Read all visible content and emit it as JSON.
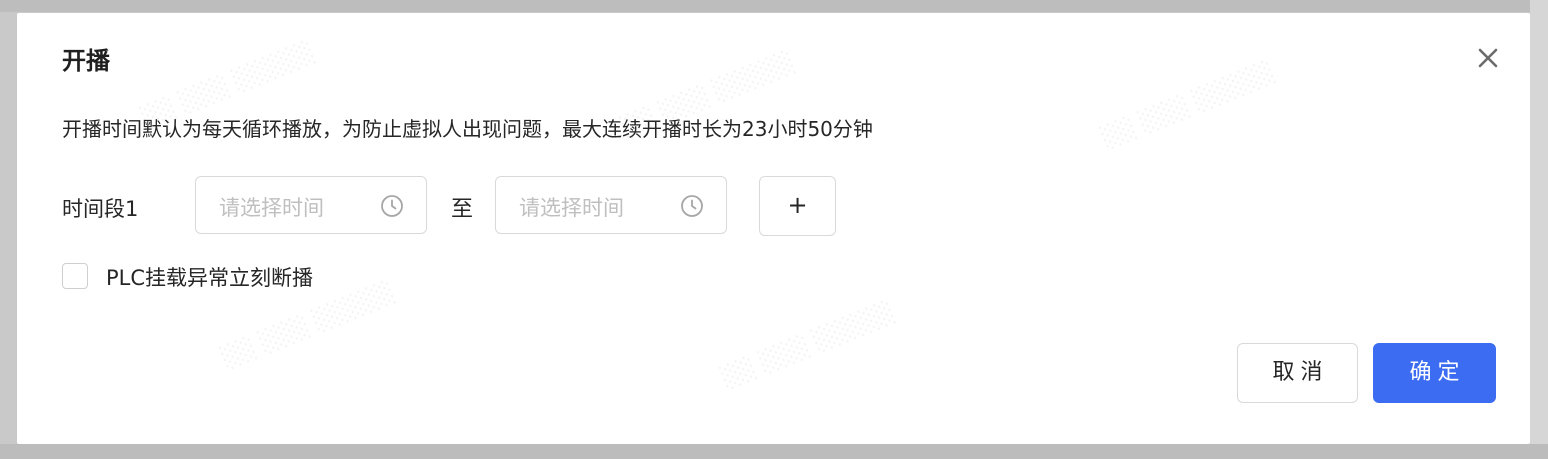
{
  "dialog": {
    "title": "开播",
    "close_icon": "close-icon",
    "notice": "开播时间默认为每天循环播放，为防止虚拟人出现问题，最大连续开播时长为23小时50分钟",
    "time_range": {
      "label": "时间段1",
      "start_placeholder": "请选择时间",
      "separator": "至",
      "end_placeholder": "请选择时间",
      "add_label": "+",
      "icon": "clock-icon"
    },
    "plc_option": {
      "checked": false,
      "label": "PLC挂载异常立刻断播"
    },
    "footer": {
      "cancel_label": "取消",
      "ok_label": "确定"
    }
  },
  "colors": {
    "primary": "#3b6cf2",
    "border": "#d9d9d9",
    "placeholder": "#bfbfbf",
    "text": "#262626",
    "backdrop": "#c9c9c9"
  }
}
